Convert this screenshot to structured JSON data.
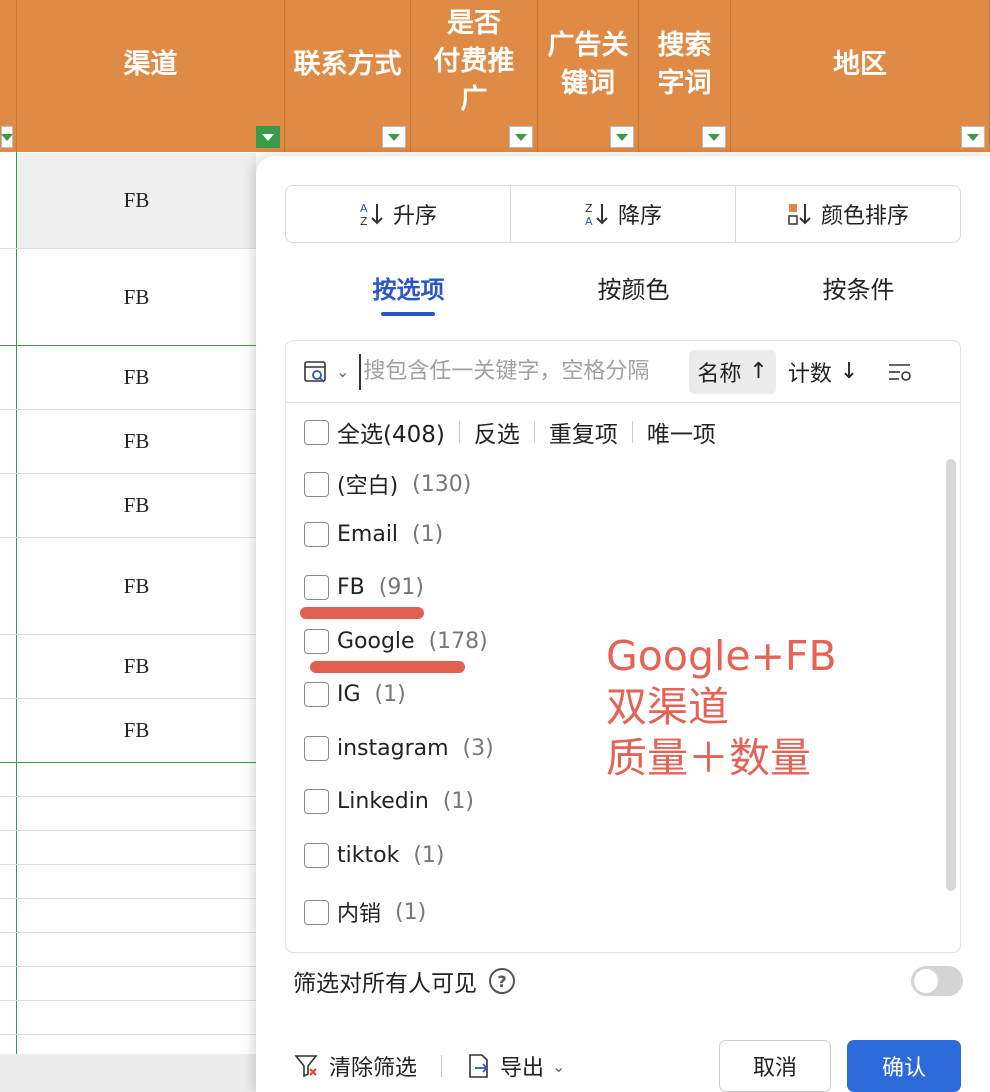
{
  "headers": [
    {
      "label": "",
      "filter": "normal"
    },
    {
      "label": "渠道",
      "filter": "active"
    },
    {
      "label": "联系方式",
      "filter": "normal"
    },
    {
      "label": "是否付费推广",
      "lines": [
        "是否",
        "付费推",
        "广"
      ],
      "filter": "normal"
    },
    {
      "label": "广告关键词",
      "lines": [
        "广告关",
        "键词"
      ],
      "filter": "normal"
    },
    {
      "label": "搜索字词",
      "lines": [
        "搜索",
        "字词"
      ],
      "filter": "normal"
    },
    {
      "label": "地区",
      "filter": "normal"
    }
  ],
  "column_cells": [
    "FB",
    "FB",
    "FB",
    "FB",
    "FB",
    "FB",
    "FB",
    "FB"
  ],
  "panel": {
    "sort_buttons": [
      {
        "icon": "sort-asc-icon",
        "label": "升序"
      },
      {
        "icon": "sort-desc-icon",
        "label": "降序"
      },
      {
        "icon": "color-sort-icon",
        "label": "颜色排序"
      }
    ],
    "tabs": [
      "按选项",
      "按颜色",
      "按条件"
    ],
    "active_tab": 0,
    "search": {
      "placeholder": "搜包含任一关键字，空格分隔",
      "sort_name": "名称",
      "sort_count": "计数"
    },
    "select_all": "全选(408)",
    "invert": "反选",
    "duplicates": "重复项",
    "unique": "唯一项",
    "items": [
      {
        "label": "(空白)",
        "count": "(130)"
      },
      {
        "label": "Email",
        "count": "(1)"
      },
      {
        "label": "FB",
        "count": "(91)"
      },
      {
        "label": "Google",
        "count": "(178)"
      },
      {
        "label": "IG",
        "count": "(1)"
      },
      {
        "label": "instagram",
        "count": "(3)"
      },
      {
        "label": "Linkedin",
        "count": "(1)"
      },
      {
        "label": "tiktok",
        "count": "(1)"
      },
      {
        "label": "内销",
        "count": "(1)"
      }
    ],
    "annotation": [
      "Google+FB",
      "双渠道",
      "质量＋数量"
    ],
    "annotation_color": "#e56255",
    "visibility_label": "筛选对所有人可见",
    "clear_filter": "清除筛选",
    "export": "导出",
    "cancel": "取消",
    "confirm": "确认"
  },
  "colors": {
    "header": "#e08b45",
    "accent": "#2a56c6",
    "primary_button": "#2c6ad9"
  }
}
